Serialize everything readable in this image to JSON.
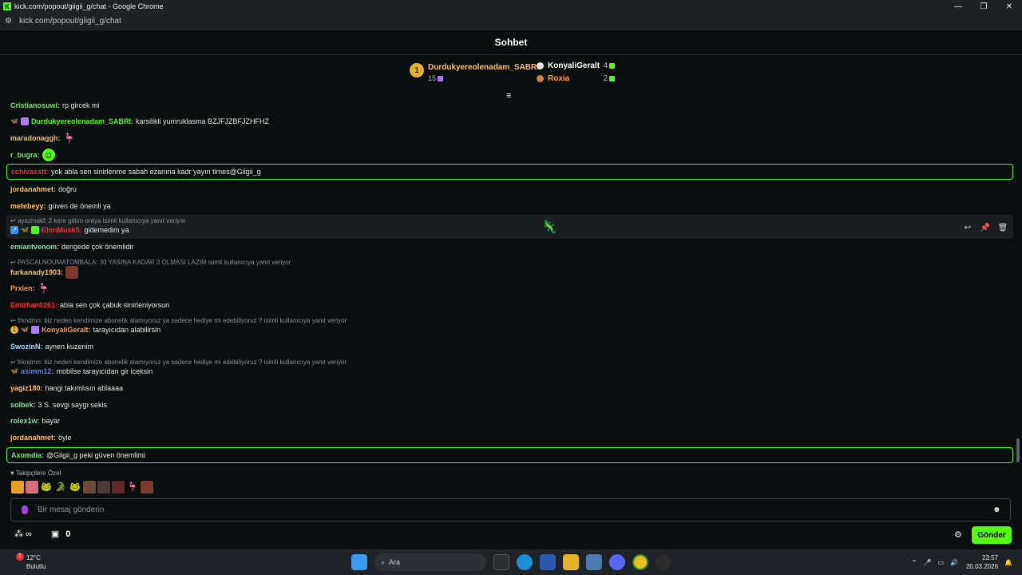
{
  "browser": {
    "window_title": "kick.com/popout/giigii_g/chat - Google Chrome",
    "url": "kick.com/popout/giigii_g/chat",
    "controls": [
      "—",
      "❐",
      "✕"
    ]
  },
  "chat": {
    "header_title": "Sohbet",
    "leaderboard": {
      "first": {
        "rank": "1",
        "name": "Durdukyereolenadam_SABRI",
        "count": "15"
      },
      "others": [
        {
          "name": "KonyaliGeralt",
          "count": "4",
          "color": "#ffffff"
        },
        {
          "name": "Roxia",
          "count": "2",
          "color": "#f4a04a"
        }
      ]
    },
    "messages": [
      {
        "user": "Cristianosuwi",
        "color": "#7fe07b",
        "text": "rp gircek mi"
      },
      {
        "user": "Durdukyereolenadam_SABRI",
        "color": "#53fc18",
        "text": "karsilikli yumruklasma BZJFJZBFJZHFHZ"
      },
      {
        "user": "maradonaggh",
        "color": "#f4c06a",
        "text": ""
      },
      {
        "user": "r_bugra",
        "color": "#7fe07b",
        "text": ""
      },
      {
        "user": "cchivasstt",
        "color": "#e8323a",
        "text": "yok abla sen sinirlenme sabah ezanına kadr yayın times@Giigii_g"
      },
      {
        "user": "jordanahmet",
        "color": "#f4c06a",
        "text": "doğru"
      },
      {
        "user": "metebeyy",
        "color": "#f4c06a",
        "text": "güven de önemli ya"
      },
      {
        "reply": "ayazmakf: 2 kere gittim oraya isimli kullanıcıya yanıt veriyor",
        "user": "ElonMusk5",
        "color": "#e8323a",
        "text": "gidemedim ya"
      },
      {
        "user": "emiantvenom",
        "color": "#7fe0a0",
        "text": "dengede çok önemlidir"
      },
      {
        "reply": "PASCALNOUMATOMBALA: 30 YASINA KADAR 3 OLMASI LAZIM isimli kullanıcıya yanıt veriyor",
        "user": "furkanady1903",
        "color": "#f4c06a",
        "text": ""
      },
      {
        "user": "Prxien",
        "color": "#f4a04a",
        "text": ""
      },
      {
        "user": "Emirhan0261",
        "color": "#e8323a",
        "text": "abla sen çok çabuk sinirleniyorsun"
      },
      {
        "reply": "frkndmn: biz neden kendimize abonelik alamıyoruz ya sadece hediye mi edebiliyoruz ? isimli kullanıcıya yanıt veriyor",
        "user": "KonyaliGeralt",
        "color": "#f4a04a",
        "text": "tarayıcıdan alabilirsin"
      },
      {
        "user": "SwozinN",
        "color": "#a8d8ff",
        "text": "aynen kuzenim"
      },
      {
        "reply": "frkndmn: biz neden kendimize abonelik alamıyoruz ya sadece hediye mi edebiliyoruz ? isimli kullanıcıya yanıt veriyor",
        "user": "asimm12",
        "color": "#5a7cf6",
        "text": "mobilse tarayıcıdan gir iceksin"
      },
      {
        "user": "yagiz180",
        "color": "#f4c06a",
        "text": "hangi takımlısın ablaaaa"
      },
      {
        "user": "solbek",
        "color": "#7fe0a0",
        "text": "3 S. sevgi saygı sekis"
      },
      {
        "user": "rolex1w",
        "color": "#7fe0a0",
        "text": "bayar"
      },
      {
        "user": "jordanahmet",
        "color": "#f4c06a",
        "text": "öyle"
      },
      {
        "user": "Axomdia",
        "color": "#7fe07b",
        "text": "@Giigii_g peki güven önemlimi"
      }
    ],
    "followers_label": "Takipçilere Özel",
    "input_placeholder": "Bir mesaj gönderin",
    "gift_count": "0",
    "send_label": "Gönder"
  },
  "taskbar": {
    "temperature": "12°C",
    "weather": "Bulutlu",
    "weather_alert": "1",
    "search_label": "Ara",
    "time": "23:57",
    "date": "20.03.2026"
  }
}
